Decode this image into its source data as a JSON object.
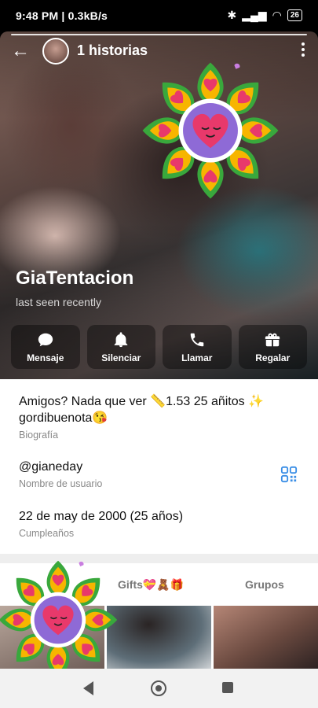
{
  "status_bar": {
    "time_speed": "9:48 PM | 0.3kB/s",
    "battery": "26"
  },
  "header": {
    "stories_label": "1 historias"
  },
  "profile": {
    "name": "GiaTentacion",
    "last_seen": "last seen recently"
  },
  "actions": [
    {
      "label": "Mensaje",
      "icon": "message-icon"
    },
    {
      "label": "Silenciar",
      "icon": "bell-icon"
    },
    {
      "label": "Llamar",
      "icon": "phone-icon"
    },
    {
      "label": "Regalar",
      "icon": "gift-icon"
    }
  ],
  "info": {
    "bio": "Amigos? Nada que ver 📏1.53 25 añitos ✨ gordibuenota😘",
    "bio_label": "Biografía",
    "username": "@gianeday",
    "username_label": "Nombre de usuario",
    "birthday": "22 de may de 2000 (25 años)",
    "birthday_label": "Cumpleaños"
  },
  "tabs": [
    {
      "label": "Gifts💝🧸🎁"
    },
    {
      "label": "Grupos"
    }
  ],
  "colors": {
    "accent": "#3a8ee6",
    "sticker_yellow": "#f7b500",
    "sticker_pink": "#e8396b",
    "sticker_purple": "#8e6ad6",
    "sticker_green": "#39a83c"
  }
}
